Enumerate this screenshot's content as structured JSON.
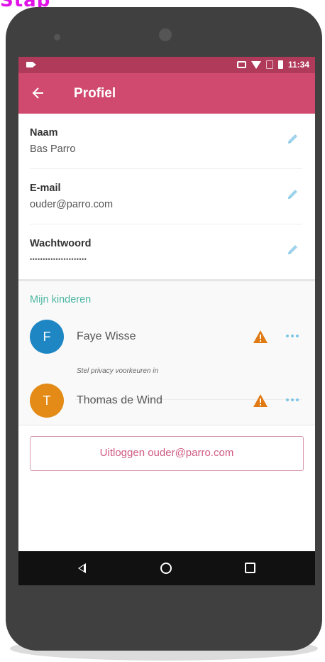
{
  "top_fragment": "Stap",
  "status_bar": {
    "time": "11:34",
    "icons": [
      "video-icon",
      "cast-icon",
      "wifi-icon",
      "no-sim-icon",
      "battery-icon"
    ]
  },
  "app_bar": {
    "title": "Profiel",
    "back_icon": "arrow-left-icon"
  },
  "profile": {
    "fields": [
      {
        "label": "Naam",
        "value": "Bas Parro"
      },
      {
        "label": "E-mail",
        "value": "ouder@parro.com"
      },
      {
        "label": "Wachtwoord",
        "value": "••••••••••••••••••••••"
      }
    ],
    "edit_icon": "pencil-icon"
  },
  "kids": {
    "heading": "Mijn kinderen",
    "children": [
      {
        "initial": "F",
        "name": "Faye Wisse",
        "avatar_color": "#1f86c4",
        "note": "Stel privacy voorkeuren in"
      },
      {
        "initial": "T",
        "name": "Thomas de Wind",
        "avatar_color": "#e38b16",
        "note": ""
      }
    ],
    "warning_color": "#e07a13",
    "more_color": "#7cc6e6"
  },
  "logout": {
    "label": "Uitloggen ouder@parro.com"
  },
  "nav": {
    "icons": [
      "back-triangle-icon",
      "home-circle-icon",
      "recents-square-icon"
    ]
  },
  "colors": {
    "status_bar": "#b03a5a",
    "app_bar": "#cf4a6e",
    "accent_teal": "#4cb6a2",
    "logout_text": "#cf5a80"
  }
}
